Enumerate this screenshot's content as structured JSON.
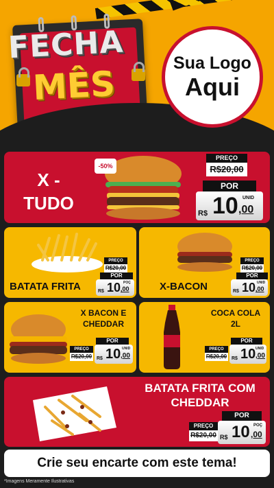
{
  "header": {
    "title_line1": "FECHA",
    "title_line2": "MÊS",
    "logo_line1": "Sua Logo",
    "logo_line2": "Aqui"
  },
  "featured": {
    "name_line1": "X -",
    "name_line2": "TUDO",
    "discount": "-50%",
    "preco_label": "PREÇO",
    "old_price": "R$20,00",
    "por_label": "POR",
    "currency": "R$",
    "price_int": "10",
    "price_cents": ",00",
    "unit": "UNID"
  },
  "products": [
    {
      "name": "BATATA FRITA",
      "preco_label": "PREÇO",
      "old_price": "R$20,00",
      "por_label": "POR",
      "currency": "R$",
      "price_int": "10",
      "price_cents": ",00",
      "unit": "POÇ"
    },
    {
      "name": "X-BACON",
      "preco_label": "PREÇO",
      "old_price": "R$20,00",
      "por_label": "POR",
      "currency": "R$",
      "price_int": "10",
      "price_cents": ",00",
      "unit": "UNID"
    },
    {
      "name_line1": "X BACON E",
      "name_line2": "CHEDDAR",
      "preco_label": "PREÇO",
      "old_price": "R$20,00",
      "por_label": "POR",
      "currency": "R$",
      "price_int": "10",
      "price_cents": ",00",
      "unit": "UNID"
    },
    {
      "name_line1": "COCA COLA",
      "name_line2": "2L",
      "preco_label": "PREÇO",
      "old_price": "R$20,00",
      "por_label": "POR",
      "currency": "R$",
      "price_int": "10",
      "price_cents": ",00",
      "unit": "UNID"
    }
  ],
  "bottom_product": {
    "name_line1": "BATATA FRITA COM",
    "name_line2": "CHEDDAR",
    "preco_label": "PREÇO",
    "old_price": "R$20,00",
    "por_label": "POR",
    "currency": "R$",
    "price_int": "10",
    "price_cents": ",00",
    "unit": "POÇ"
  },
  "footer": {
    "cta": "Crie seu encarte com este tema!",
    "disclaimer": "*Imagens Meramente Ilustrativas"
  },
  "colors": {
    "brand_red": "#c8102e",
    "brand_yellow": "#f6b800",
    "header_orange": "#f5a500",
    "dark": "#1d1d1d"
  }
}
